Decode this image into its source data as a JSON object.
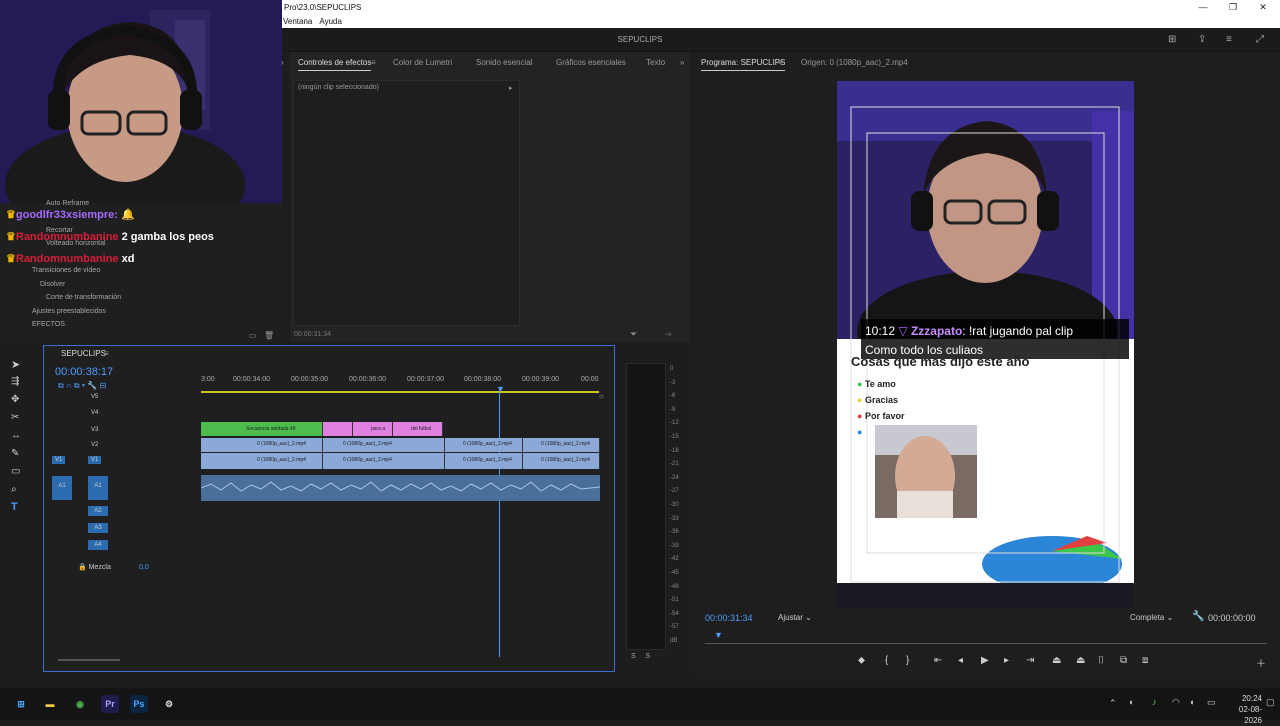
{
  "window": {
    "title": "Pro\\23.0\\SEPUCLIPS",
    "menu": [
      "Ventana",
      "Ayuda"
    ],
    "app_name": "SEPUCLIPS"
  },
  "chat": [
    {
      "user": "goodlfr33xsiempre:",
      "msg": "",
      "color": "#a56bff"
    },
    {
      "user": "Randomnumbanine",
      "msg": "2 gamba los peos",
      "color": "#d81f3a"
    },
    {
      "user": "Randomnumbanine",
      "msg": "xd",
      "color": "#d81f3a"
    }
  ],
  "effects_tree": [
    "Auto Reframe",
    "Recortar",
    "Volteado horizontal",
    "Transiciones de vídeo",
    "Disolver",
    "Corte de transformación",
    "Ajustes preestablecidos",
    "EFECTOS"
  ],
  "effects_panel": {
    "tabs": [
      "Controles de efectos",
      "Color de Lumetri",
      "Sonido esencial",
      "Gráficos esenciales",
      "Texto"
    ],
    "no_clip": "(ningún clip seleccionado)",
    "timecode": "00:00:31:34"
  },
  "program": {
    "tab": "Programa: SEPUCLIPS",
    "source": "Origen: 0 (1080p_aac)_2.mp4",
    "timecode": "00:00:31:34",
    "fit": "Ajustar",
    "quality": "Completa",
    "duration": "00:00:00:00",
    "overlay_time": "10:12",
    "overlay_user": "Zzzapato",
    "overlay_line1": ": !rat jugando pal clip",
    "overlay_line2": "Como todo los culiaos",
    "poll_title": "Cosas que mas dijo este año",
    "poll_items": [
      {
        "label": "Te amo",
        "color": "#3cc64a"
      },
      {
        "label": "Gracias",
        "color": "#e8d23a"
      },
      {
        "label": "Por favor",
        "color": "#e04040"
      },
      {
        "label": "",
        "color": "#2b86d8"
      }
    ]
  },
  "timeline": {
    "sequence": "SEPUCLIPS",
    "timecode": "00:00:38:17",
    "ruler": [
      "3:00",
      "00:00:34:00",
      "00:00:35:00",
      "00:00:36:00",
      "00:00:37:00",
      "00:00:38:00",
      "00:00:39:00",
      "00:00"
    ],
    "video_tracks": [
      "V5",
      "V4",
      "V3",
      "V2",
      "V1"
    ],
    "audio_tracks": [
      "A1",
      "A2",
      "A3",
      "A4"
    ],
    "mix_label": "Mezcla",
    "mix_value": "0,0",
    "clips_v3": [
      "Secuencia anidada 48",
      "",
      "para a",
      "del futbol"
    ],
    "clip_name": "0 (1080p_aac)_2.mp4"
  },
  "meter": [
    "0",
    "-3",
    "-6",
    "-9",
    "-12",
    "-15",
    "-18",
    "-21",
    "-24",
    "-27",
    "-30",
    "-33",
    "-36",
    "-39",
    "-42",
    "-45",
    "-48",
    "-51",
    "-54",
    "-57",
    "dB"
  ],
  "taskbar": {
    "time": "20:24",
    "date": "02-08-2026"
  }
}
